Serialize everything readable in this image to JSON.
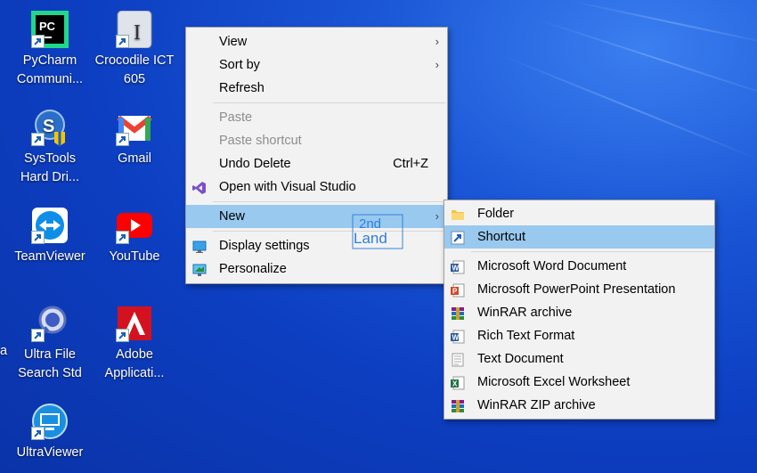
{
  "desktop": {
    "icons": [
      {
        "id": "pycharm",
        "label": "PyCharm\nCommuni..."
      },
      {
        "id": "crocodile",
        "label": "Crocodile ICT\n605"
      },
      {
        "id": "systools",
        "label": "SysTools\nHard Dri..."
      },
      {
        "id": "gmail",
        "label": "Gmail"
      },
      {
        "id": "teamviewer",
        "label": "TeamViewer"
      },
      {
        "id": "youtube",
        "label": "YouTube"
      },
      {
        "id": "ultrafile",
        "label": "Ultra File\nSearch Std"
      },
      {
        "id": "adobe",
        "label": "Adobe\nApplicati..."
      },
      {
        "id": "ultraviewer",
        "label": "UltraViewer"
      }
    ],
    "partial_left_label": "a"
  },
  "context_menu": {
    "view": "View",
    "sort_by": "Sort by",
    "refresh": "Refresh",
    "paste": "Paste",
    "paste_shortcut": "Paste shortcut",
    "undo_delete": "Undo Delete",
    "undo_shortcut": "Ctrl+Z",
    "open_vs": "Open with Visual Studio",
    "new": "New",
    "display_settings": "Display settings",
    "personalize": "Personalize"
  },
  "new_submenu": {
    "folder": "Folder",
    "shortcut": "Shortcut",
    "word": "Microsoft Word Document",
    "powerpoint": "Microsoft PowerPoint Presentation",
    "winrar": "WinRAR archive",
    "rtf": "Rich Text Format",
    "text": "Text Document",
    "excel": "Microsoft Excel Worksheet",
    "winrar_zip": "WinRAR ZIP archive"
  },
  "watermark": {
    "line1": "2nd",
    "line2": "Land"
  },
  "colors": {
    "menu_bg": "#f2f2f2",
    "hover": "#99c9ef",
    "disabled": "#8d8d8d",
    "desktop": "#0d3fc2"
  }
}
